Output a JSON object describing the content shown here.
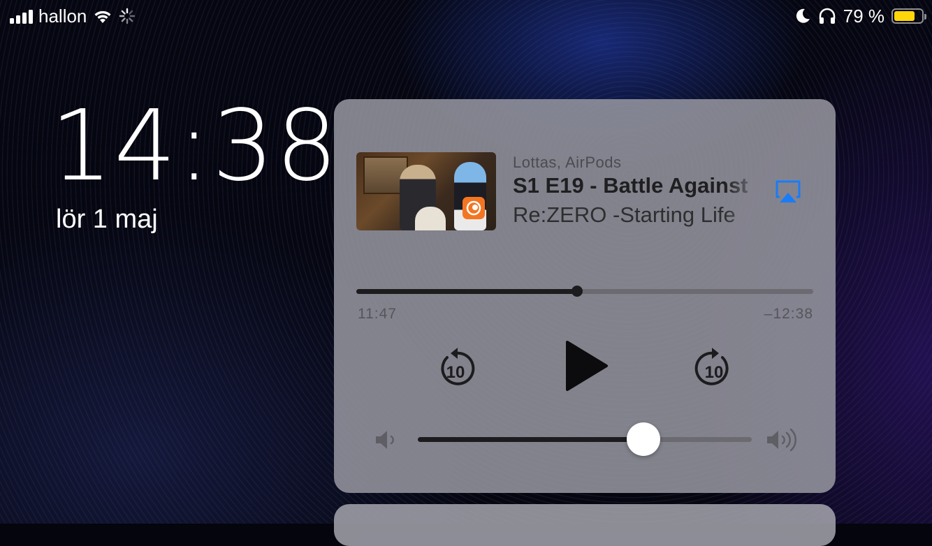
{
  "status_bar": {
    "carrier": "hallon",
    "signal_bars": 4,
    "icons": [
      "cellular-signal-icon",
      "wifi-icon",
      "activity-spinner-icon",
      "moon-icon",
      "headphones-icon",
      "battery-icon"
    ],
    "battery_percent_label": "79 %",
    "battery_level": 0.79,
    "battery_color": "#ffd60a"
  },
  "lock_screen": {
    "time": "14:38",
    "date": "lör 1 maj"
  },
  "now_playing": {
    "source": "Lottas, AirPods",
    "title": "S1 E19 - Battle Against",
    "subtitle": "Re:ZERO -Starting Life",
    "app_badge_icon": "crunchyroll-icon",
    "airplay_icon": "airplay-icon",
    "accent_color": "#1a7cf5",
    "elapsed": "11:47",
    "remaining": "–12:38",
    "progress_fraction": 0.483,
    "controls": {
      "skip_back_label": "10",
      "skip_forward_label": "10"
    },
    "volume_fraction": 0.675
  }
}
